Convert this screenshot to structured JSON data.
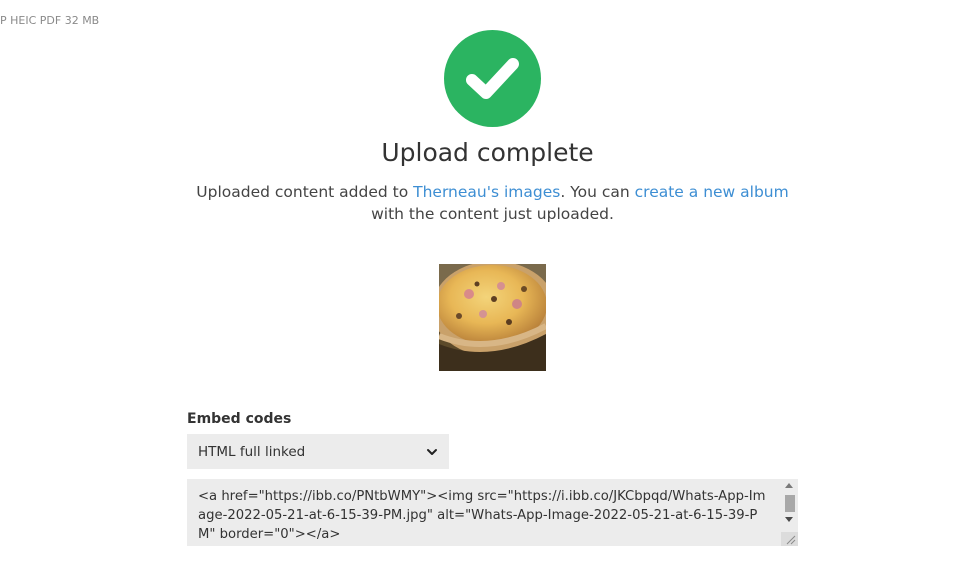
{
  "header": {
    "format_hint": "P HEIC PDF  32 MB"
  },
  "status": {
    "icon": "check-icon",
    "accent_color": "#2bb461",
    "title": "Upload complete"
  },
  "message": {
    "prefix": "Uploaded content added to ",
    "album_link": "Therneau's images",
    "middle": ". You can ",
    "create_link": "create a new album",
    "suffix": " with the content just uploaded.",
    "link_color": "#3d8ed3"
  },
  "thumbnail": {
    "subject": "pizza-photo"
  },
  "embed": {
    "label": "Embed codes",
    "selected_option": "HTML full linked",
    "code": "<a href=\"https://ibb.co/PNtbWMY\"><img src=\"https://i.ibb.co/JKCbpqd/Whats-App-Image-2022-05-21-at-6-15-39-PM.jpg\" alt=\"Whats-App-Image-2022-05-21-at-6-15-39-PM\" border=\"0\"></a>"
  }
}
